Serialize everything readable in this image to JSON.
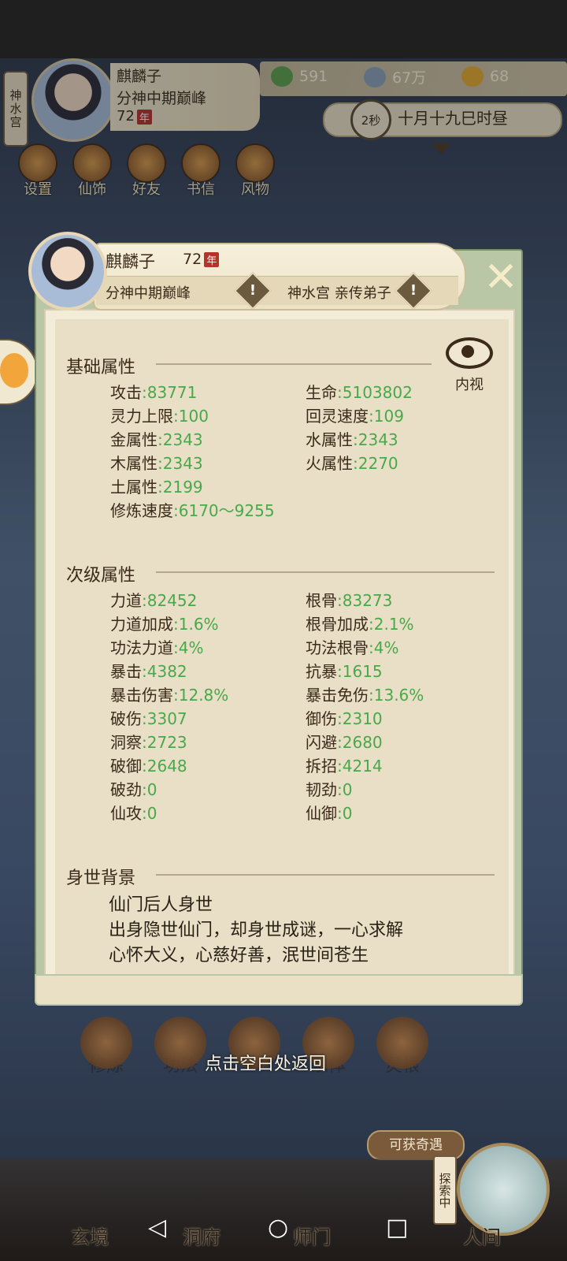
{
  "hud": {
    "sect_tab": "神水宫",
    "name": "麒麟子",
    "realm": "分神中期巅峰",
    "age": "72",
    "age_unit": "年",
    "resources": [
      {
        "icon": "leaf-icon",
        "value": "591"
      },
      {
        "icon": "coin-icon",
        "value": "67万"
      },
      {
        "icon": "trophy-icon",
        "value": "68"
      }
    ],
    "time_seconds": "2秒",
    "time_text": "十月十九巳时昼",
    "menu": [
      "设置",
      "仙饰",
      "好友",
      "书信",
      "风物"
    ]
  },
  "panel": {
    "name": "麒麟子",
    "age": "72",
    "age_unit": "年",
    "realm": "分神中期巅峰",
    "sect": "神水宫 亲传弟子",
    "warn_mark": "!",
    "close_label": "✕",
    "eye_label": "内视",
    "basic_title": "基础属性",
    "basic": [
      {
        "label": "攻击",
        "value": "83771"
      },
      {
        "label": "生命",
        "value": "5103802"
      },
      {
        "label": "灵力上限",
        "value": "100"
      },
      {
        "label": "回灵速度",
        "value": "109"
      },
      {
        "label": "金属性",
        "value": "2343"
      },
      {
        "label": "水属性",
        "value": "2343"
      },
      {
        "label": "木属性",
        "value": "2343"
      },
      {
        "label": "火属性",
        "value": "2270"
      },
      {
        "label": "土属性",
        "value": "2199"
      },
      {
        "label": "修炼速度",
        "value": "6170～9255"
      }
    ],
    "secondary_title": "次级属性",
    "secondary": [
      {
        "label": "力道",
        "value": "82452"
      },
      {
        "label": "根骨",
        "value": "83273"
      },
      {
        "label": "力道加成",
        "value": "1.6%"
      },
      {
        "label": "根骨加成",
        "value": "2.1%"
      },
      {
        "label": "功法力道",
        "value": "4%"
      },
      {
        "label": "功法根骨",
        "value": "4%"
      },
      {
        "label": "暴击",
        "value": "4382"
      },
      {
        "label": "抗暴",
        "value": "1615"
      },
      {
        "label": "暴击伤害",
        "value": "12.8%"
      },
      {
        "label": "暴击免伤",
        "value": "13.6%"
      },
      {
        "label": "破伤",
        "value": "3307"
      },
      {
        "label": "御伤",
        "value": "2310"
      },
      {
        "label": "洞察",
        "value": "2723"
      },
      {
        "label": "闪避",
        "value": "2680"
      },
      {
        "label": "破御",
        "value": "2648"
      },
      {
        "label": "拆招",
        "value": "4214"
      },
      {
        "label": "破劲",
        "value": "0"
      },
      {
        "label": "韧劲",
        "value": "0"
      },
      {
        "label": "仙攻",
        "value": "0"
      },
      {
        "label": "仙御",
        "value": "0"
      }
    ],
    "background_title": "身世背景",
    "background_lines": [
      "仙门后人身世",
      "出身隐世仙门，却身世成谜，一心求解",
      "心怀大义，心慈好善，泯世间苍生"
    ]
  },
  "bottom": {
    "actions": [
      "修炼",
      "功法",
      "",
      "宗体",
      "灵根"
    ],
    "hint": "点击空白处返回",
    "opportunity": "可获奇遇",
    "explore": "探索中",
    "nav_labels": [
      "玄境",
      "洞府",
      "师门",
      "人间"
    ],
    "nav_buttons": [
      "◁",
      "○",
      "□"
    ]
  },
  "colors": {
    "value_green": "#49a84a",
    "year_badge": "#b4342c"
  }
}
